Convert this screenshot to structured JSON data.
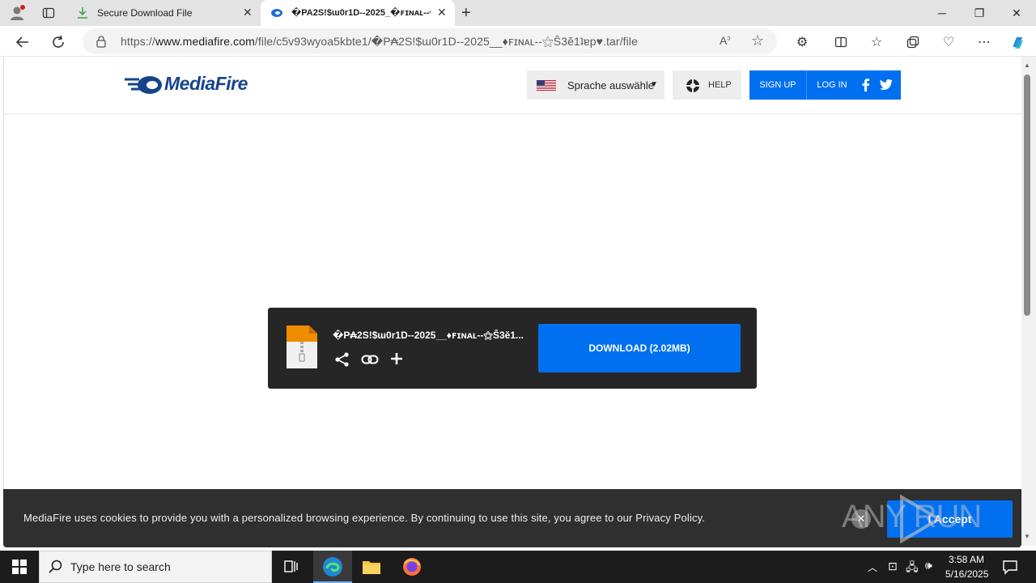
{
  "browser": {
    "tabs": [
      {
        "title": "Secure Download File",
        "active": false
      },
      {
        "title": "�PA2S!$ɯ0r1D--2025_�ꜰɪɴᴀʟ--⚝",
        "active": true
      }
    ],
    "url_prefix": "https://",
    "url_domain": "www.mediafire.com",
    "url_path": "/file/c5v93wyoa5kbte1/�P₳2S!$ɯ0r1D--2025__♦ꜰɪɴᴀʟ--⚝Ŝ3ĕ1ʇɐp♥.tar/file"
  },
  "site": {
    "logo_text": "MediaFire",
    "language_label": "Sprache auswähle",
    "help_label": "HELP",
    "signup_label": "SIGN UP",
    "login_label": "LOG IN"
  },
  "download": {
    "file_name": "�P₳2S!$ɯ0r1D--2025__♦ꜰɪɴᴀʟ--⚝Ŝ3ĕ1...",
    "button_label": "DOWNLOAD (2.02MB)"
  },
  "cookie_banner": {
    "text": "MediaFire uses cookies to provide you with a personalized browsing experience. By continuing to use this site, you agree to our Privacy Policy.",
    "accept_label": "I Accept",
    "watermark": "ANY RUN"
  },
  "taskbar": {
    "search_placeholder": "Type here to search",
    "time": "3:58 AM",
    "date": "5/16/2025"
  },
  "colors": {
    "brand_blue": "#0070f0",
    "logo_blue": "#15448c",
    "card_bg": "#262626"
  }
}
